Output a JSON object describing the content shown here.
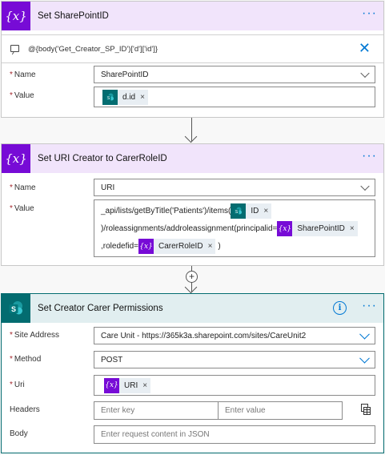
{
  "card1": {
    "title": "Set SharePointID",
    "icon_glyph": "{x}",
    "expression": "@{body('Get_Creator_SP_ID')['d']['id']}",
    "close_glyph": "╳",
    "name_label": "Name",
    "name_value": "SharePointID",
    "value_label": "Value",
    "value_token": "d.id"
  },
  "card2": {
    "title": "Set URI Creator to CarerRoleID",
    "icon_glyph": "{x}",
    "name_label": "Name",
    "name_value": "URI",
    "value_label": "Value",
    "line1_text": "_api/lists/getByTitle('Patients')/items(",
    "line1_token": "ID",
    "line2_text": ")/roleassignments/addroleassignment(principalid=",
    "line2_token": "SharePointID",
    "line3_text": ",roledefid=",
    "line3_token": "CarerRoleID",
    "line3_tail": ")"
  },
  "card3": {
    "title": "Set Creator Carer Permissions",
    "info_glyph": "i",
    "site_label": "Site Address",
    "site_value": "Care Unit - https://365k3a.sharepoint.com/sites/CareUnit2",
    "method_label": "Method",
    "method_value": "POST",
    "uri_label": "Uri",
    "uri_token": "URI",
    "headers_label": "Headers",
    "headers_key_placeholder": "Enter key",
    "headers_value_placeholder": "Enter value",
    "body_label": "Body",
    "body_placeholder": "Enter request content in JSON"
  },
  "common": {
    "required_mark": "*",
    "more_glyph": "···",
    "remove_glyph": "×",
    "plus_glyph": "+",
    "token_var_glyph": "{x}"
  },
  "colors": {
    "variable_accent": "#770bd6",
    "variable_header_bg": "#f1e4fb",
    "sharepoint_accent": "#036c70",
    "sharepoint_header_bg": "#e1eef0",
    "link_blue": "#0078d4",
    "required_red": "#a4262c"
  },
  "icons": [
    "variable-icon",
    "sharepoint-icon",
    "comment-icon",
    "close-icon",
    "more-icon",
    "info-icon",
    "chevron-down-icon",
    "table-mode-icon",
    "plus-icon",
    "arrow-down-icon"
  ]
}
